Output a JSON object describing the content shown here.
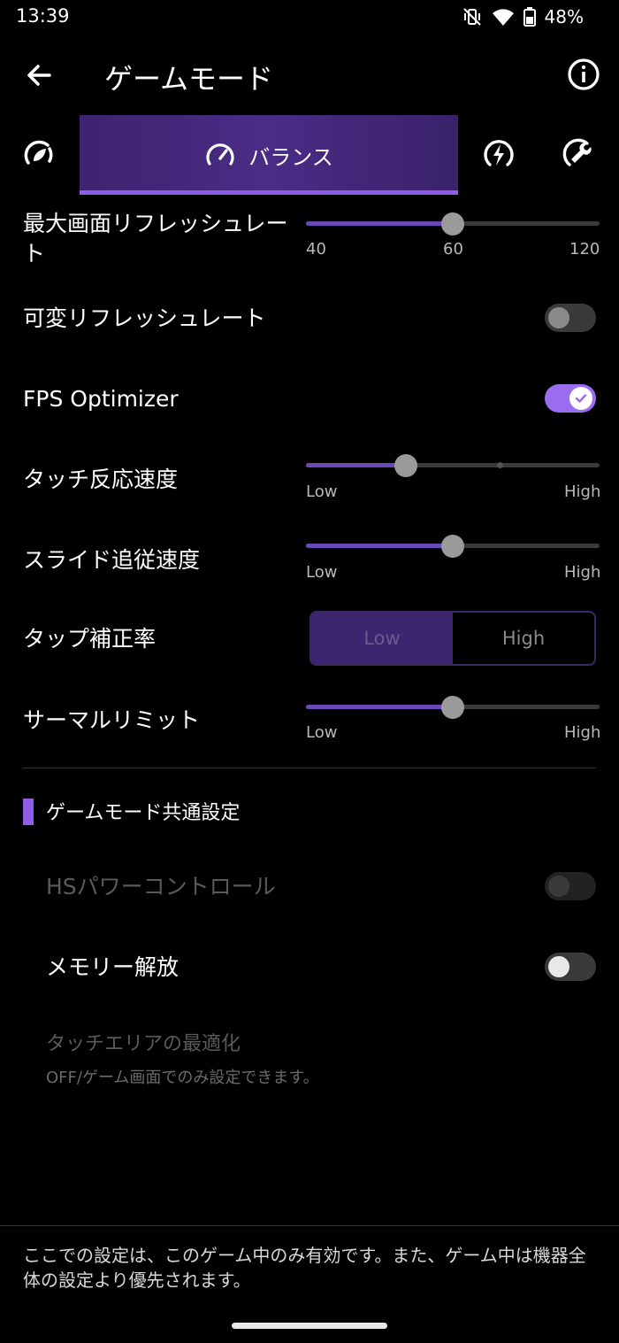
{
  "status_bar": {
    "time": "13:39",
    "battery": "48%"
  },
  "header": {
    "title": "ゲームモード"
  },
  "modes": {
    "selected_label": "バランス"
  },
  "settings": {
    "refresh_rate": {
      "label": "最大画面リフレッシュレート",
      "ticks": [
        "40",
        "60",
        "120"
      ],
      "value": 60
    },
    "variable_refresh": {
      "label": "可変リフレッシュレート",
      "checked": false
    },
    "fps_optimizer": {
      "label": "FPS Optimizer",
      "checked": true
    },
    "touch_speed": {
      "label": "タッチ反応速度",
      "min_label": "Low",
      "max_label": "High",
      "level": 0.33
    },
    "slide_speed": {
      "label": "スライド追従速度",
      "min_label": "Low",
      "max_label": "High",
      "level": 0.5
    },
    "tap_correction": {
      "label": "タップ補正率",
      "options": [
        "Low",
        "High"
      ],
      "selected": "Low"
    },
    "thermal_limit": {
      "label": "サーマルリミット",
      "min_label": "Low",
      "max_label": "High",
      "level": 0.5
    }
  },
  "common": {
    "section_title": "ゲームモード共通設定",
    "hs_power": {
      "label": "HSパワーコントロール",
      "enabled": false
    },
    "memory_release": {
      "label": "メモリー解放",
      "checked": false
    },
    "touch_area": {
      "label": "タッチエリアの最適化",
      "sublabel": "OFF/ゲーム画面でのみ設定できます。"
    }
  },
  "footer": {
    "note": "ここでの設定は、このゲーム中のみ有効です。また、ゲーム中は機器全体の設定より優先されます。"
  },
  "colors": {
    "accent": "#9b6cf0",
    "selected_tab": "#4a2c86"
  }
}
